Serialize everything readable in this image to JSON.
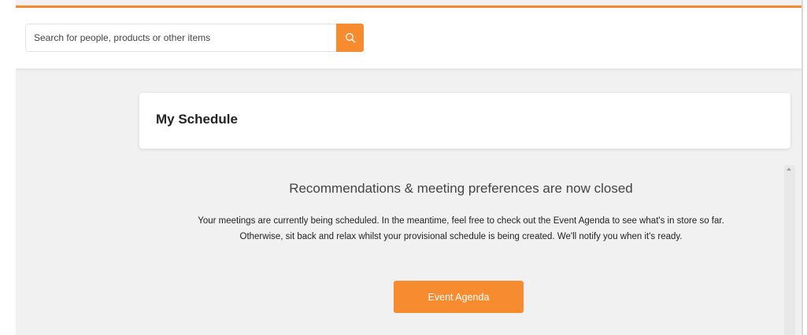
{
  "search": {
    "placeholder": "Search for people, products or other items",
    "icon": "search-icon"
  },
  "page": {
    "title": "My Schedule"
  },
  "notice": {
    "heading": "Recommendations & meeting preferences are now closed",
    "line1": "Your meetings are currently being scheduled. In the meantime, feel free to check out the Event Agenda to see what's in store so far.",
    "line2": "Otherwise, sit back and relax whilst your provisional schedule is being created. We'll notify you when it's ready."
  },
  "actions": {
    "agenda_label": "Event Agenda"
  },
  "colors": {
    "accent": "#f78b2f",
    "background": "#f1f1f1",
    "card": "#ffffff"
  }
}
